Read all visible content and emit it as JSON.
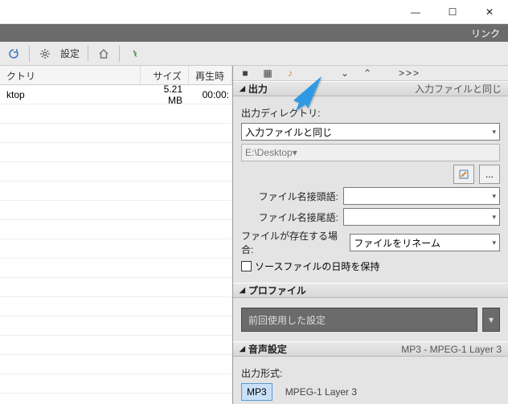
{
  "titlebar": {
    "min": "—",
    "max": "☐",
    "close": "✕"
  },
  "menubar": {
    "link": "リンク"
  },
  "toolbar": {
    "settings": "設定"
  },
  "left": {
    "cols": [
      "クトリ",
      "サイズ",
      "再生時"
    ],
    "rows": [
      {
        "name": "ktop",
        "size": "5.21 MB",
        "dur": "00:00:"
      }
    ]
  },
  "right": {
    "toolbar": {
      "more": ">>>"
    },
    "output": {
      "title": "出力",
      "note": "入力ファイルと同じ",
      "dirlabel": "出力ディレクトリ:",
      "dirval": "入力ファイルと同じ",
      "path": "E:\\Desktop",
      "browse": "...",
      "prefix": "ファイル名接頭語:",
      "suffix": "ファイル名接尾語:",
      "exists": "ファイルが存在する場合:",
      "existsval": "ファイルをリネーム",
      "keepdate": "ソースファイルの日時を保持"
    },
    "profile": {
      "title": "プロファイル",
      "val": "前回使用した設定"
    },
    "audio": {
      "title": "音声設定",
      "note": "MP3 - MPEG-1 Layer 3",
      "formatlabel": "出力形式:",
      "sel": "MP3",
      "desc": "MPEG-1 Layer 3"
    }
  }
}
